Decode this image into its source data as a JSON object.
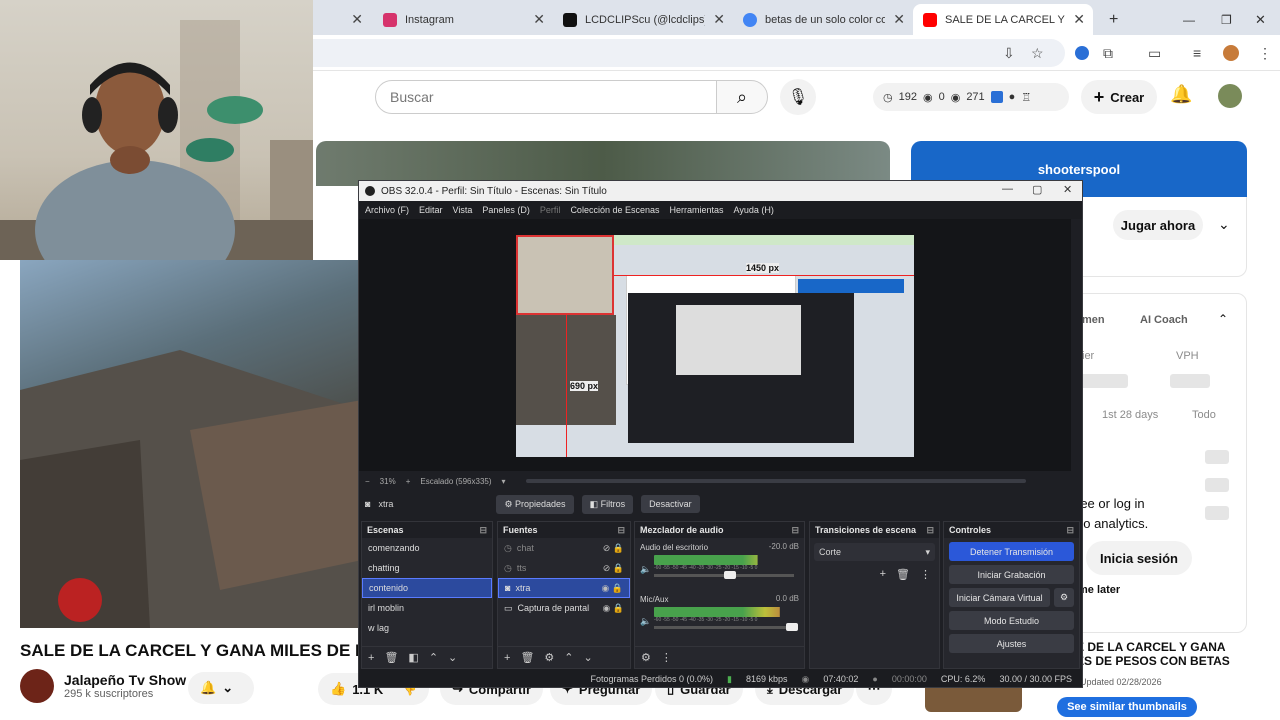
{
  "tabs": [
    {
      "label": "Instagram",
      "color": "#d6336c",
      "active": false
    },
    {
      "label": "LCDCLIPScu (@lcdclips) | TikTok",
      "color": "#111111",
      "active": false
    },
    {
      "label": "betas de un solo color con",
      "color": "#4285f4",
      "active": false
    },
    {
      "label": "SALE DE LA CARCEL Y GANA",
      "color": "#ff0000",
      "active": true
    }
  ],
  "youtube": {
    "search_placeholder": "Buscar",
    "stats": {
      "a": "192",
      "b": "0",
      "c": "271"
    },
    "create_label": "Crear",
    "video_title": "SALE DE LA CARCEL Y GANA MILES DE PESOS CON BETAS",
    "channel_name": "Jalapeño Tv Show",
    "subscribers": "295 k suscriptores",
    "likes": "1.1 K",
    "share_label": "Compartir",
    "ask_label": "Preguntar",
    "save_label": "Guardar",
    "download_label": "Descargar",
    "ad_brand": "shooterspool",
    "ad_button": "Jugar ahora",
    "ad_tab": "men",
    "ai_coach": "AI Coach",
    "vph": "VPH",
    "ier": "ier",
    "period_1": "1st 28 days",
    "period_2": "Todo",
    "login_text_1": "ree or log in",
    "login_text_2": "eo analytics.",
    "login_button": "Inicia sesión",
    "later": "me later",
    "rec_title_1": "E DE LA CARCEL Y GANA",
    "rec_title_2": "ES DE PESOS CON BETAS",
    "rec_date": "Updated 02/28/2026",
    "similar": "See similar thumbnails"
  },
  "obs": {
    "title": "OBS 32.0.4 - Perfil: Sin Título - Escenas: Sin Título",
    "menu": [
      "Archivo (F)",
      "Editar",
      "Vista",
      "Paneles (D)",
      "Perfil",
      "Colección de Escenas",
      "Herramientas",
      "Ayuda (H)"
    ],
    "dim_px_h": "1450 px",
    "dim_px_v": "690 px",
    "zoom": "31%",
    "scale": "Escalado (596x335)",
    "source_name": "xtra",
    "properties": "Propiedades",
    "filters": "Filtros",
    "deactivate": "Desactivar",
    "docks": {
      "scenes": "Escenas",
      "sources": "Fuentes",
      "mixer": "Mezclador de audio",
      "transitions": "Transiciones de escena",
      "controls": "Controles"
    },
    "scenes": [
      "comenzando",
      "chatting",
      "contenido",
      "irl moblin",
      "w lag"
    ],
    "selected_scene": "contenido",
    "sources": [
      "chat",
      "tts",
      "xtra",
      "Captura de pantal"
    ],
    "mixer": [
      {
        "name": "Audio del escritorio",
        "db": "-20.0 dB",
        "level": 0.7
      },
      {
        "name": "Mic/Aux",
        "db": "0.0 dB",
        "level": 0.85
      }
    ],
    "meter_scale": "-60 -55 -50 -45 -40 -35 -30 -25 -20 -15 -10 -5 0",
    "transition": "Corte",
    "controls": [
      "Detener Transmisión",
      "Iniciar Grabación",
      "Iniciar Cámara Virtual",
      "Modo Estudio",
      "Ajustes"
    ],
    "status": {
      "dropped": "Fotogramas Perdidos 0 (0.0%)",
      "kbps": "8169 kbps",
      "live": "07:40:02",
      "rec": "00:00:00",
      "cpu": "CPU: 6.2%",
      "fps": "30.00 / 30.00 FPS"
    }
  }
}
